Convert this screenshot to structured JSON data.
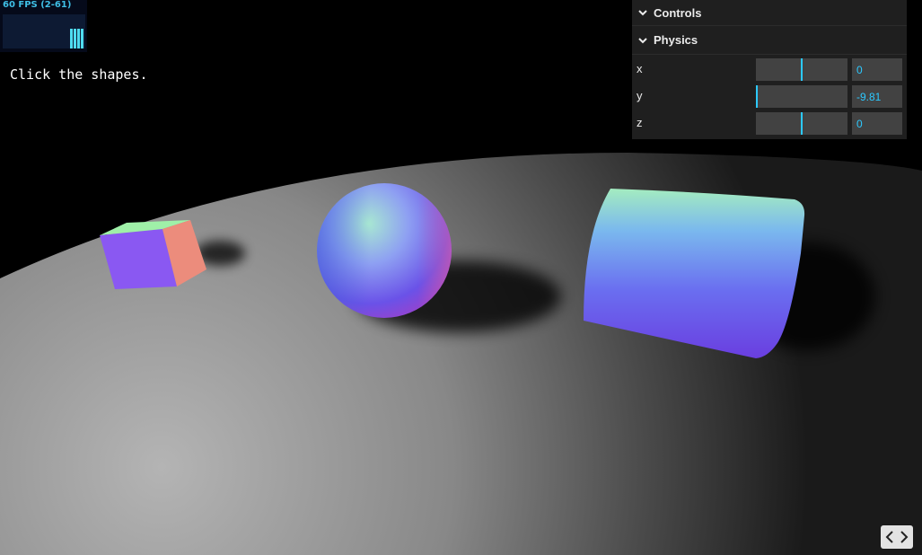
{
  "stats": {
    "fps_text": "60 FPS (2-61)"
  },
  "hint": "Click the shapes.",
  "gui": {
    "controls_title": "Controls",
    "physics_title": "Physics",
    "gravity": [
      {
        "label": "x",
        "value": "0",
        "fraction": 0.5
      },
      {
        "label": "y",
        "value": "-9.81",
        "fraction": 0.0
      },
      {
        "label": "z",
        "value": "0",
        "fraction": 0.5
      }
    ]
  },
  "source_button": {
    "icon": "code-icon"
  },
  "colors": {
    "accent": "#2cc9ff",
    "panel": "#1f1f1f",
    "field": "#424242"
  }
}
